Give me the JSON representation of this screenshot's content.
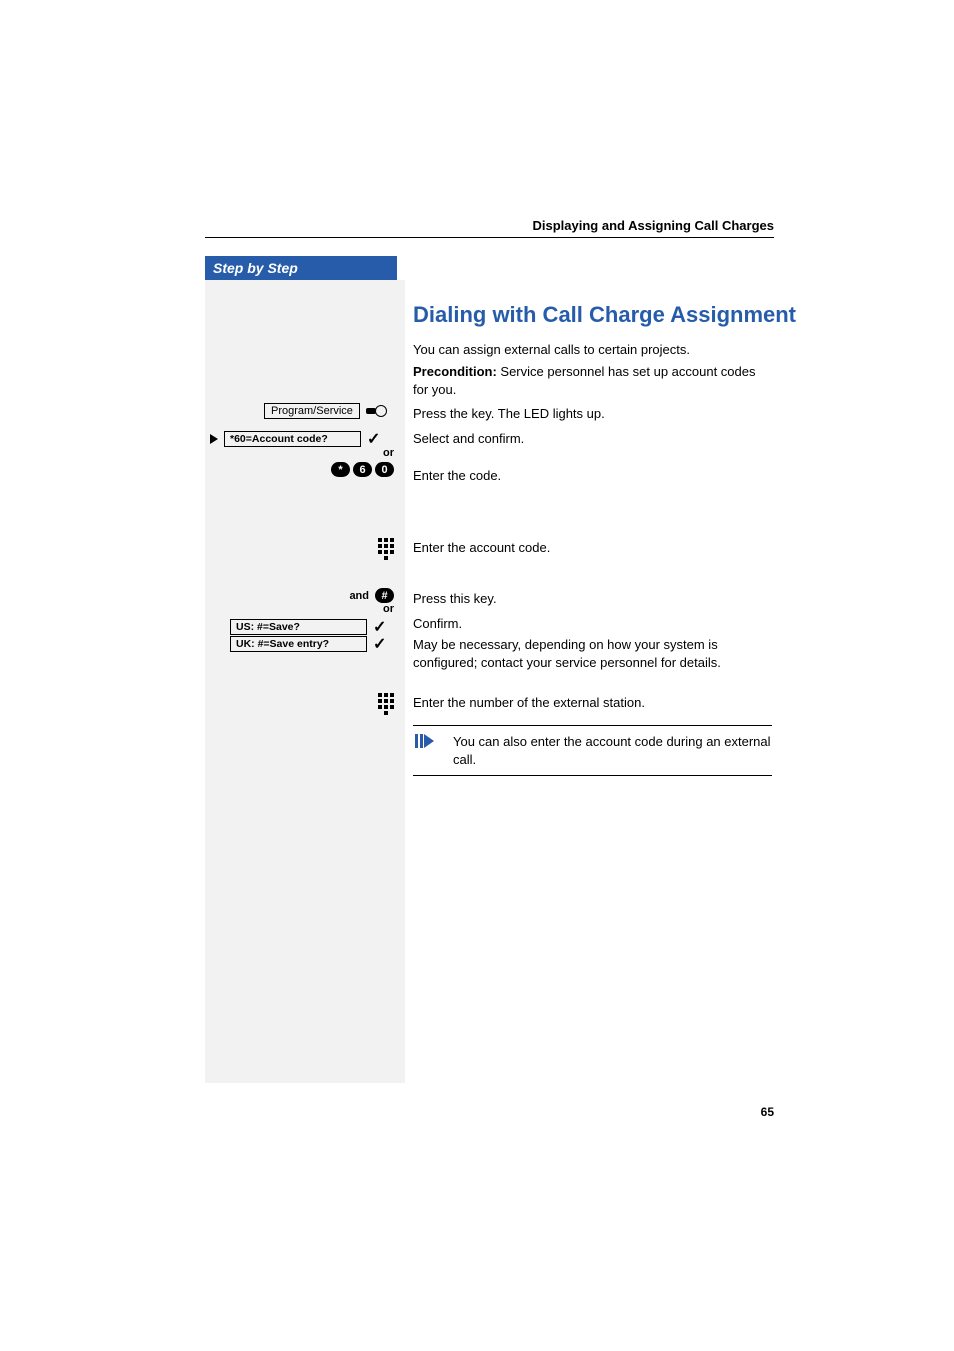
{
  "header": {
    "section": "Displaying and Assigning Call Charges"
  },
  "sidebar": {
    "title": "Step by Step",
    "prog_service": "Program/Service",
    "account_code_menu": "*60=Account code?",
    "or1": "or",
    "code_keys": [
      "*",
      "6",
      "0"
    ],
    "and_label": "and",
    "hash_key": "#",
    "or2": "or",
    "us_save": "US: #=Save?",
    "uk_save": "UK: #=Save entry?"
  },
  "section_title": "Dialing with Call Charge Assignment",
  "body": {
    "intro": "You can assign external calls to certain projects.",
    "precondition_label": "Precondition:",
    "precondition_text": " Service personnel has set up account codes for you.",
    "press_key": "Press the key. The LED lights up.",
    "select_confirm": "Select and confirm.",
    "enter_code": "Enter the code.",
    "enter_account": "Enter the account code.",
    "press_this": "Press this key.",
    "confirm": "Confirm.",
    "config_note": "May be necessary, depending on how your system is configured; contact your service personnel for details.",
    "enter_external": "Enter the number of the external station.",
    "note_box": "You can also enter the account code during an external call."
  },
  "page_number": "65"
}
